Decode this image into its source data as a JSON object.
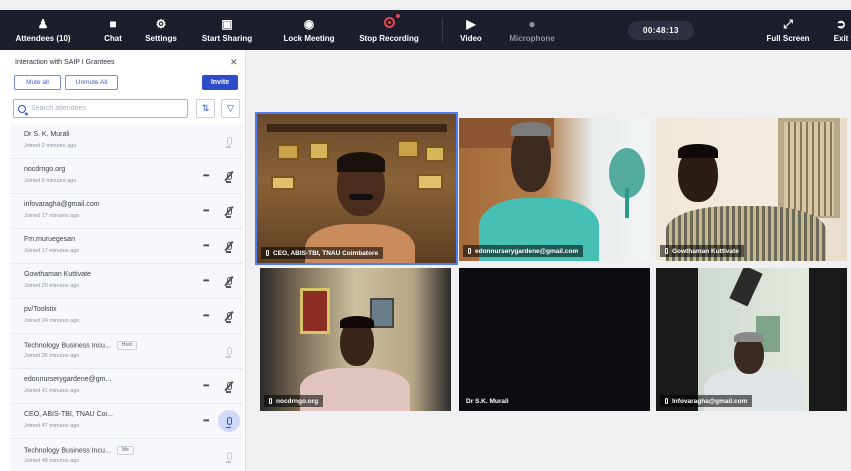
{
  "toolbar": {
    "attendees": "Attendees (10)",
    "chat": "Chat",
    "settings": "Settings",
    "start_sharing": "Start Sharing",
    "lock_meeting": "Lock Meeting",
    "stop_recording": "Stop Recording",
    "video": "Video",
    "microphone": "Microphone",
    "timer": "00:48:13",
    "full_screen": "Full Screen",
    "exit": "Exit"
  },
  "panel": {
    "title": "Interaction with SAIP I Grantees",
    "mute_all": "Mute all",
    "unmute_all": "Unmute All",
    "invite": "Invite",
    "search_placeholder": "Search attendees",
    "participants": [
      {
        "name": "Dr S. K. Murali",
        "status": "Joined 2 minutes ago",
        "mic": "off",
        "tag": ""
      },
      {
        "name": "nocdrngo.org",
        "status": "Joined 8 minutes ago",
        "mic": "on",
        "tag": ""
      },
      {
        "name": "infovaragha@gmail.com",
        "status": "Joined 17 minutes ago",
        "mic": "on",
        "tag": ""
      },
      {
        "name": "Fm.muruegesan",
        "status": "Joined 17 minutes ago",
        "mic": "on",
        "tag": ""
      },
      {
        "name": "Gowthaman Kuttivate",
        "status": "Joined 20 minutes ago",
        "mic": "on",
        "tag": ""
      },
      {
        "name": "pv/Toolstix",
        "status": "Joined 24 minutes ago",
        "mic": "on",
        "tag": ""
      },
      {
        "name": "Technology Business Incu...",
        "status": "Joined 26 minutes ago",
        "mic": "off",
        "tag": "Host"
      },
      {
        "name": "edonnurserygardene@gm...",
        "status": "Joined 41 minutes ago",
        "mic": "on",
        "tag": ""
      },
      {
        "name": "CEO, ABIS-TBI, TNAU Coi...",
        "status": "Joined 47 minutes ago",
        "mic": "active",
        "tag": ""
      },
      {
        "name": "Technology Business Incu...",
        "status": "Joined 48 minutes ago",
        "mic": "off",
        "tag": "Me"
      }
    ]
  },
  "videos": [
    {
      "label": "CEO, ABIS-TBI, TNAU Coimbatore",
      "has_video": true
    },
    {
      "label": "edonnurserygardene@gmail.com",
      "has_video": true
    },
    {
      "label": "Gowthaman Kuttivate",
      "has_video": true
    },
    {
      "label": "nocdrngo.org",
      "has_video": true
    },
    {
      "label": "Dr S.K. Murali",
      "has_video": false
    },
    {
      "label": "Infovaragha@gmail.com",
      "has_video": true
    }
  ],
  "colors": {
    "toolbar_bg": "#1c1f2b",
    "accent": "#2d4cc8",
    "record": "#e5484d",
    "active_tile_border": "#4f7df0"
  }
}
